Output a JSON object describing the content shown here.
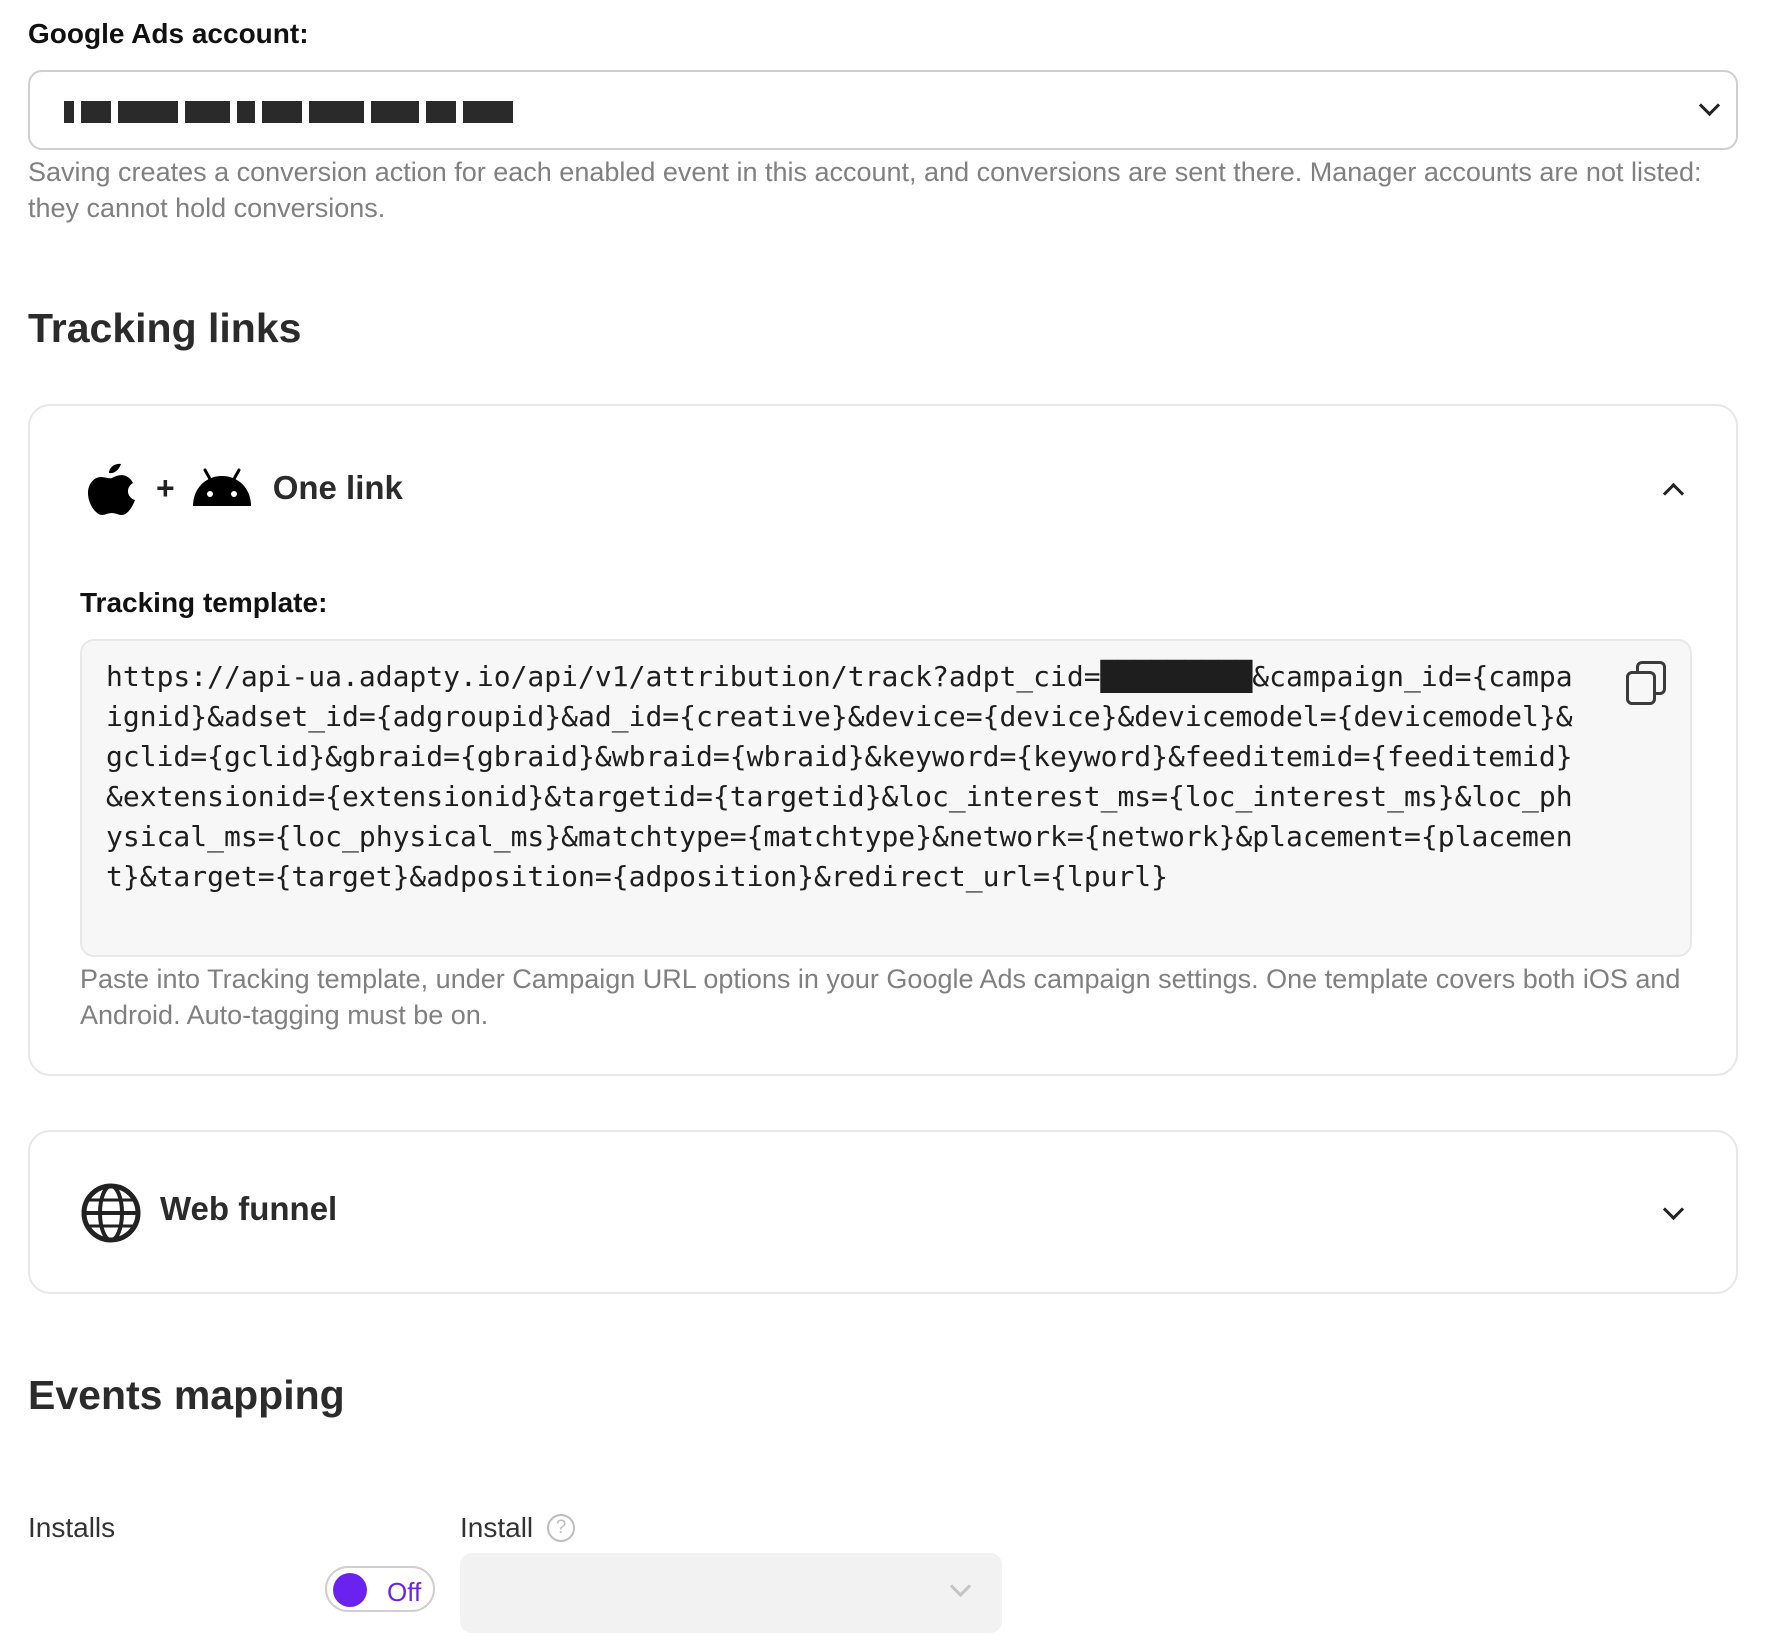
{
  "account": {
    "label": "Google Ads account:",
    "help": "Saving creates a conversion action for each enabled event in this account, and conversions are sent there. Manager accounts are not listed: they cannot hold conversions."
  },
  "tracking": {
    "title": "Tracking links",
    "one_link": {
      "title": "One link",
      "template_label": "Tracking template:",
      "template": "https://api-ua.adapty.io/api/v1/attribution/track?adpt_cid=█████████&campaign_id={campaignid}&adset_id={adgroupid}&ad_id={creative}&device={device}&devicemodel={devicemodel}&gclid={gclid}&gbraid={gbraid}&wbraid={wbraid}&keyword={keyword}&feeditemid={feeditemid}&extensionid={extensionid}&targetid={targetid}&loc_interest_ms={loc_interest_ms}&loc_physical_ms={loc_physical_ms}&matchtype={matchtype}&network={network}&placement={placement}&target={target}&adposition={adposition}&redirect_url={lpurl}",
      "help": "Paste into Tracking template, under Campaign URL options in your Google Ads campaign settings. One template covers both iOS and Android. Auto-tagging must be on."
    },
    "web_funnel": {
      "title": "Web funnel"
    }
  },
  "events": {
    "title": "Events mapping",
    "installs": {
      "label": "Installs",
      "toggle_label": "Off",
      "event_label": "Install",
      "help_mark": "?"
    }
  },
  "colors": {
    "accent": "#6a22f0",
    "muted_text": "#808080"
  },
  "icons": [
    "chevron-down-icon",
    "chevron-up-icon",
    "apple-icon",
    "android-icon",
    "globe-icon",
    "copy-icon",
    "help-icon"
  ]
}
